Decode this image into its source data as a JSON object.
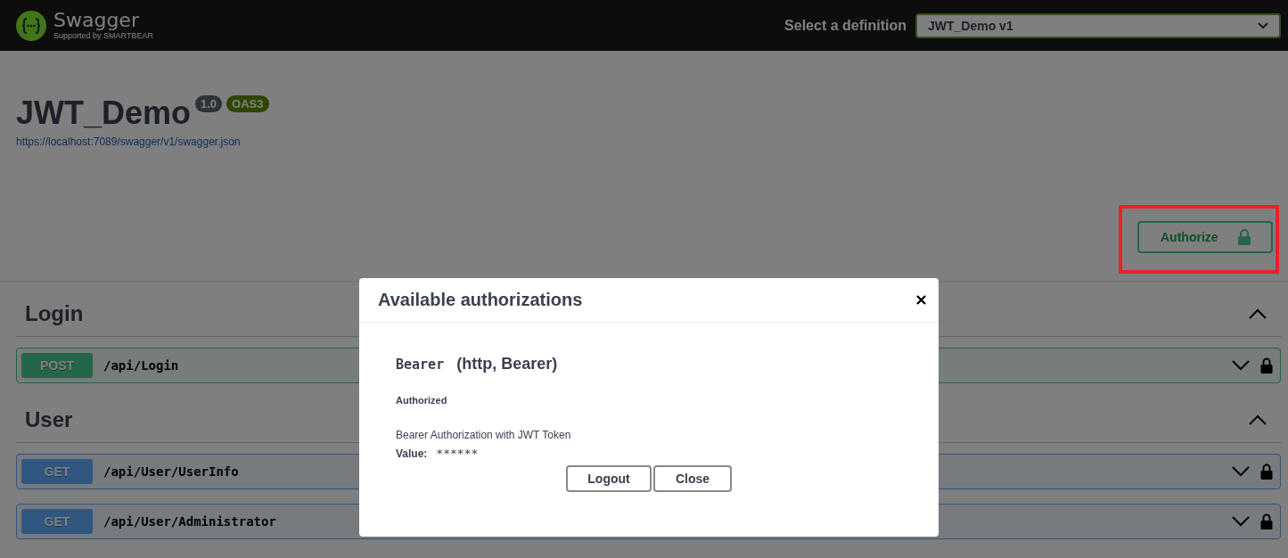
{
  "topbar": {
    "logo_text": "Swagger",
    "logo_subtext": "Supported by SMARTBEAR",
    "definition_label": "Select a definition",
    "definition_value": "JWT_Demo v1"
  },
  "info": {
    "title": "JWT_Demo",
    "version": "1.0",
    "oas_badge": "OAS3",
    "spec_url": "https://localhost:7089/swagger/v1/swagger.json"
  },
  "authorize_button": {
    "label": "Authorize",
    "highlighted": true
  },
  "tags": [
    {
      "name": "Login",
      "expanded": true,
      "operations": [
        {
          "method": "POST",
          "path": "/api/Login",
          "locked": true
        }
      ]
    },
    {
      "name": "User",
      "expanded": true,
      "operations": [
        {
          "method": "GET",
          "path": "/api/User/UserInfo",
          "locked": true
        },
        {
          "method": "GET",
          "path": "/api/User/Administrator",
          "locked": true
        }
      ]
    }
  ],
  "modal": {
    "title": "Available authorizations",
    "scheme_name": "Bearer",
    "scheme_type": "(http, Bearer)",
    "status": "Authorized",
    "description": "Bearer Authorization with JWT Token",
    "value_label": "Value:",
    "value": "******",
    "buttons": [
      "Logout",
      "Close"
    ]
  }
}
